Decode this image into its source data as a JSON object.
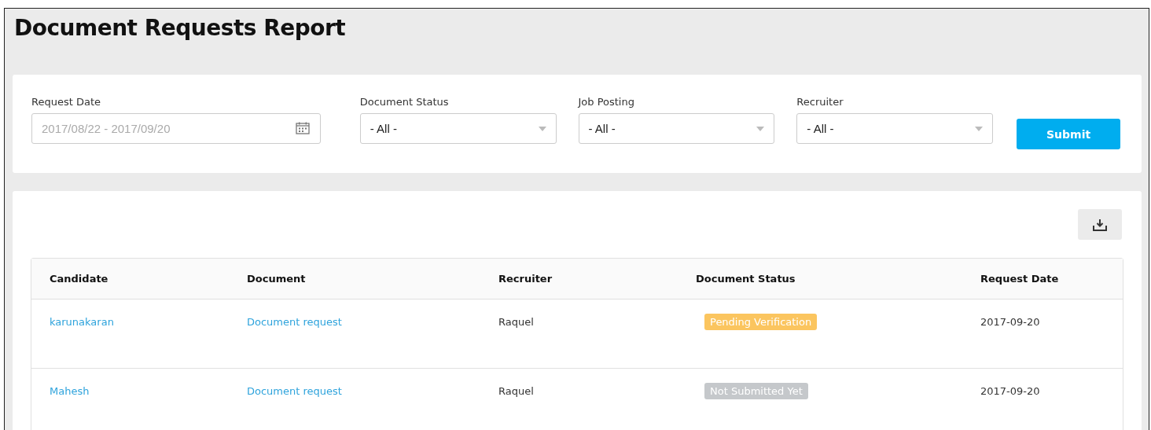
{
  "title": "Document Requests Report",
  "filters": [
    {
      "kind": "date",
      "label": "Request Date",
      "placeholder": "2017/08/22 - 2017/09/20"
    },
    {
      "kind": "select",
      "label": "Document Status",
      "value": "- All -"
    },
    {
      "kind": "select",
      "label": "Job Posting",
      "value": "- All -"
    },
    {
      "kind": "select",
      "label": "Recruiter",
      "value": "- All -"
    }
  ],
  "submit": "Submit",
  "table": {
    "columns": [
      "Candidate",
      "Document",
      "Recruiter",
      "Document Status",
      "Request Date"
    ],
    "rows": [
      {
        "candidate": "karunakaran",
        "document": "Document request",
        "recruiter": "Raquel",
        "status": "Pending Verification",
        "color": "#fbc55f",
        "date": "2017-09-20"
      },
      {
        "candidate": "Mahesh",
        "document": "Document request",
        "recruiter": "Raquel",
        "status": "Not Submitted Yet",
        "color": "#c5c8cb",
        "date": "2017-09-20"
      }
    ]
  }
}
